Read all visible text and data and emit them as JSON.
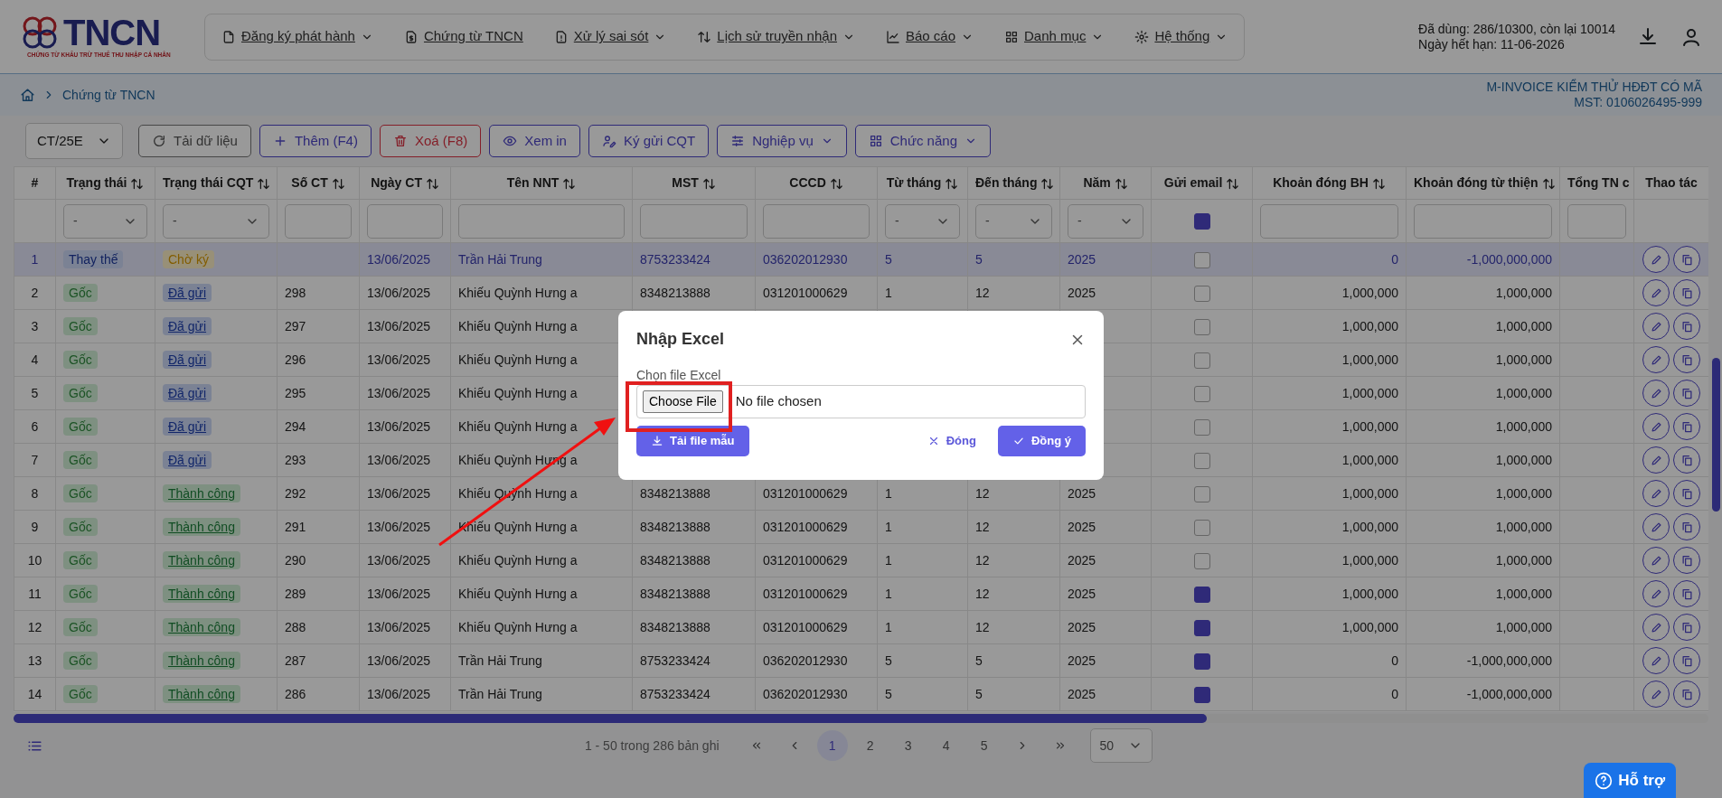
{
  "header": {
    "logo": {
      "text": "TNCN",
      "tagline": "CHỨNG TỪ KHẤU TRỪ THUẾ THU NHẬP CÁ NHÂN"
    },
    "nav": [
      {
        "label": "Đăng ký phát hành",
        "dropdown": true
      },
      {
        "label": "Chứng từ TNCN",
        "dropdown": false
      },
      {
        "label": "Xử lý sai sót",
        "dropdown": true
      },
      {
        "label": "Lịch sử truyền nhận",
        "dropdown": true
      },
      {
        "label": "Báo cáo",
        "dropdown": true
      },
      {
        "label": "Danh mục",
        "dropdown": true
      },
      {
        "label": "Hệ thống",
        "dropdown": true
      }
    ],
    "usage": "Đã dùng: 286/10300, còn lại 10014",
    "expiry": "Ngày hết hạn: 11-06-2026"
  },
  "breadcrumb": {
    "items": [
      "Chứng từ TNCN"
    ],
    "company": "M-INVOICE KIỂM THỬ HĐĐT CÓ MÃ",
    "tax_code": "MST: 0106026495-999"
  },
  "toolbar": {
    "series": "CT/25E",
    "buttons": [
      {
        "label": "Tải dữ liệu",
        "kind": "secondary",
        "dropdown": false
      },
      {
        "label": "Thêm (F4)",
        "kind": "primary",
        "dropdown": false
      },
      {
        "label": "Xoá (F8)",
        "kind": "danger",
        "dropdown": false
      },
      {
        "label": "Xem in",
        "kind": "primary",
        "dropdown": false
      },
      {
        "label": "Ký gửi CQT",
        "kind": "primary",
        "dropdown": false
      },
      {
        "label": "Nghiệp vụ",
        "kind": "primary",
        "dropdown": true
      },
      {
        "label": "Chức năng",
        "kind": "primary",
        "dropdown": true
      }
    ]
  },
  "table": {
    "columns": [
      {
        "label": "#",
        "sortable": false
      },
      {
        "label": "Trạng thái",
        "sortable": true,
        "filter": {
          "kind": "select",
          "value": "-"
        }
      },
      {
        "label": "Trạng thái CQT",
        "sortable": true,
        "filter": {
          "kind": "select",
          "value": "-"
        }
      },
      {
        "label": "Số CT",
        "sortable": true,
        "filter": {
          "kind": "field"
        }
      },
      {
        "label": "Ngày CT",
        "sortable": true,
        "filter": {
          "kind": "field"
        }
      },
      {
        "label": "Tên NNT",
        "sortable": true,
        "filter": {
          "kind": "field"
        }
      },
      {
        "label": "MST",
        "sortable": true,
        "filter": {
          "kind": "field"
        }
      },
      {
        "label": "CCCD",
        "sortable": true,
        "filter": {
          "kind": "field"
        }
      },
      {
        "label": "Từ tháng",
        "sortable": true,
        "filter": {
          "kind": "select",
          "value": "-"
        }
      },
      {
        "label": "Đến tháng",
        "sortable": true,
        "filter": {
          "kind": "select",
          "value": "-"
        }
      },
      {
        "label": "Năm",
        "sortable": true,
        "filter": {
          "kind": "select",
          "value": "-"
        }
      },
      {
        "label": "Gửi email",
        "sortable": true,
        "filter": {
          "kind": "checkbox",
          "checked": true
        }
      },
      {
        "label": "Khoản đóng BH",
        "sortable": true,
        "filter": {
          "kind": "field"
        }
      },
      {
        "label": "Khoản đóng từ thiện",
        "sortable": true,
        "filter": {
          "kind": "field"
        }
      },
      {
        "label": "Tổng TN c",
        "filter": {
          "kind": "field"
        }
      },
      {
        "label": "Thao tác",
        "sortable": false
      }
    ],
    "rows": [
      {
        "selected": true,
        "cells": [
          "1",
          {
            "text": "Thay thế",
            "kind": "replaced",
            "link": false
          },
          {
            "text": "Chờ ký",
            "kind": "pending",
            "link": false
          },
          "",
          "13/06/2025",
          "Trần Hải Trung",
          "8753233424",
          "036202012930",
          "5",
          "5",
          "2025",
          false,
          "0",
          "-1,000,000,000",
          ""
        ]
      },
      {
        "selected": false,
        "cells": [
          "2",
          {
            "text": "Gốc",
            "kind": "original",
            "link": false
          },
          {
            "text": "Đã gửi",
            "kind": "sent",
            "link": true
          },
          "298",
          "13/06/2025",
          "Khiếu Quỳnh Hưng a",
          "8348213888",
          "031201000629",
          "1",
          "12",
          "2025",
          false,
          "1,000,000",
          "1,000,000",
          ""
        ]
      },
      {
        "selected": false,
        "cells": [
          "3",
          {
            "text": "Gốc",
            "kind": "original",
            "link": false
          },
          {
            "text": "Đã gửi",
            "kind": "sent",
            "link": true
          },
          "297",
          "13/06/2025",
          "Khiếu Quỳnh Hưng a",
          null,
          null,
          null,
          null,
          null,
          false,
          "1,000,000",
          "1,000,000",
          ""
        ]
      },
      {
        "selected": false,
        "cells": [
          "4",
          {
            "text": "Gốc",
            "kind": "original",
            "link": false
          },
          {
            "text": "Đã gửi",
            "kind": "sent",
            "link": true
          },
          "296",
          "13/06/2025",
          "Khiếu Quỳnh Hưng a",
          null,
          null,
          null,
          null,
          null,
          false,
          "1,000,000",
          "1,000,000",
          ""
        ]
      },
      {
        "selected": false,
        "cells": [
          "5",
          {
            "text": "Gốc",
            "kind": "original",
            "link": false
          },
          {
            "text": "Đã gửi",
            "kind": "sent",
            "link": true
          },
          "295",
          "13/06/2025",
          "Khiếu Quỳnh Hưng a",
          null,
          null,
          null,
          null,
          null,
          false,
          "1,000,000",
          "1,000,000",
          ""
        ]
      },
      {
        "selected": false,
        "cells": [
          "6",
          {
            "text": "Gốc",
            "kind": "original",
            "link": false
          },
          {
            "text": "Đã gửi",
            "kind": "sent",
            "link": true
          },
          "294",
          "13/06/2025",
          "Khiếu Quỳnh Hưng a",
          null,
          null,
          null,
          null,
          null,
          false,
          "1,000,000",
          "1,000,000",
          ""
        ]
      },
      {
        "selected": false,
        "cells": [
          "7",
          {
            "text": "Gốc",
            "kind": "original",
            "link": false
          },
          {
            "text": "Đã gửi",
            "kind": "sent",
            "link": true
          },
          "293",
          "13/06/2025",
          "Khiếu Quỳnh Hưng a",
          null,
          null,
          null,
          null,
          null,
          false,
          "1,000,000",
          "1,000,000",
          ""
        ]
      },
      {
        "selected": false,
        "cells": [
          "8",
          {
            "text": "Gốc",
            "kind": "original",
            "link": false
          },
          {
            "text": "Thành công",
            "kind": "success",
            "link": true
          },
          "292",
          "13/06/2025",
          "Khiếu Quỳnh Hưng a",
          "8348213888",
          "031201000629",
          "1",
          "12",
          "2025",
          false,
          "1,000,000",
          "1,000,000",
          ""
        ]
      },
      {
        "selected": false,
        "cells": [
          "9",
          {
            "text": "Gốc",
            "kind": "original",
            "link": false
          },
          {
            "text": "Thành công",
            "kind": "success",
            "link": true
          },
          "291",
          "13/06/2025",
          "Khiếu Quỳnh Hưng a",
          "8348213888",
          "031201000629",
          "1",
          "12",
          "2025",
          false,
          "1,000,000",
          "1,000,000",
          ""
        ]
      },
      {
        "selected": false,
        "cells": [
          "10",
          {
            "text": "Gốc",
            "kind": "original",
            "link": false
          },
          {
            "text": "Thành công",
            "kind": "success",
            "link": true
          },
          "290",
          "13/06/2025",
          "Khiếu Quỳnh Hưng a",
          "8348213888",
          "031201000629",
          "1",
          "12",
          "2025",
          false,
          "1,000,000",
          "1,000,000",
          ""
        ]
      },
      {
        "selected": false,
        "cells": [
          "11",
          {
            "text": "Gốc",
            "kind": "original",
            "link": false
          },
          {
            "text": "Thành công",
            "kind": "success",
            "link": true
          },
          "289",
          "13/06/2025",
          "Khiếu Quỳnh Hưng a",
          "8348213888",
          "031201000629",
          "1",
          "12",
          "2025",
          true,
          "1,000,000",
          "1,000,000",
          ""
        ]
      },
      {
        "selected": false,
        "cells": [
          "12",
          {
            "text": "Gốc",
            "kind": "original",
            "link": false
          },
          {
            "text": "Thành công",
            "kind": "success",
            "link": true
          },
          "288",
          "13/06/2025",
          "Khiếu Quỳnh Hưng a",
          "8348213888",
          "031201000629",
          "1",
          "12",
          "2025",
          true,
          "1,000,000",
          "1,000,000",
          ""
        ]
      },
      {
        "selected": false,
        "cells": [
          "13",
          {
            "text": "Gốc",
            "kind": "original",
            "link": false
          },
          {
            "text": "Thành công",
            "kind": "success",
            "link": true
          },
          "287",
          "13/06/2025",
          "Trần Hải Trung",
          "8753233424",
          "036202012930",
          "5",
          "5",
          "2025",
          true,
          "0",
          "-1,000,000,000",
          ""
        ]
      },
      {
        "selected": false,
        "cells": [
          "14",
          {
            "text": "Gốc",
            "kind": "original",
            "link": false
          },
          {
            "text": "Thành công",
            "kind": "success",
            "link": true
          },
          "286",
          "13/06/2025",
          "Trần Hải Trung",
          "8753233424",
          "036202012930",
          "5",
          "5",
          "2025",
          true,
          "0",
          "-1,000,000,000",
          ""
        ]
      }
    ]
  },
  "pagination": {
    "summary": "1 - 50 trong 286 bản ghi",
    "pages": [
      {
        "label": "1",
        "selected": true
      },
      {
        "label": "2",
        "selected": false
      },
      {
        "label": "3",
        "selected": false
      },
      {
        "label": "4",
        "selected": false
      },
      {
        "label": "5",
        "selected": false
      }
    ],
    "page_size": "50"
  },
  "help": {
    "label": "Hỗ trợ"
  },
  "modal": {
    "title": "Nhập Excel",
    "label": "Chọn file Excel",
    "file_button": "Choose File",
    "file_status": "No file chosen",
    "buttons": [
      {
        "label": "Tải file mẫu",
        "kind": "template"
      },
      {
        "label": "Đóng",
        "kind": "close"
      },
      {
        "label": "Đồng ý",
        "kind": "confirm"
      }
    ]
  }
}
